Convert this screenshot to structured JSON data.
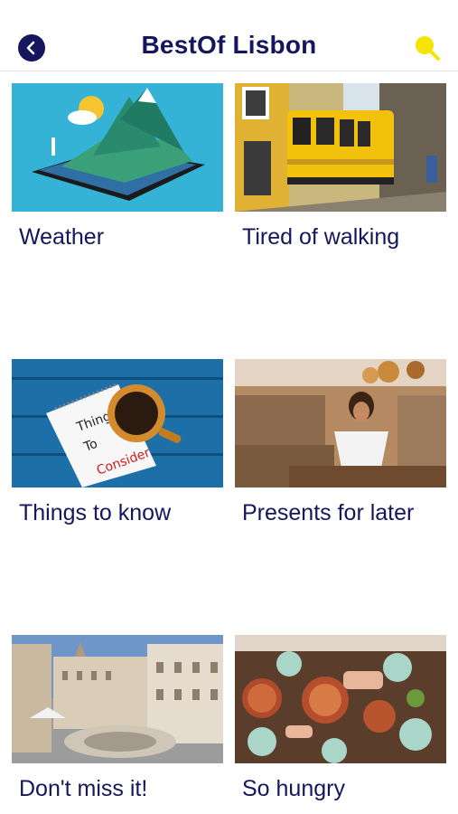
{
  "header": {
    "title": "BestOf Lisbon",
    "back_icon": "chevron-left-icon",
    "search_icon": "search-icon",
    "accent_color": "#16165e",
    "search_color": "#f5e400"
  },
  "cards": [
    {
      "label": "Weather"
    },
    {
      "label": "Tired of walking"
    },
    {
      "label": "Things to know",
      "note_text": [
        "Things",
        "To",
        "Consider"
      ]
    },
    {
      "label": "Presents for later"
    },
    {
      "label": "Don't miss it!"
    },
    {
      "label": "So hungry"
    }
  ]
}
